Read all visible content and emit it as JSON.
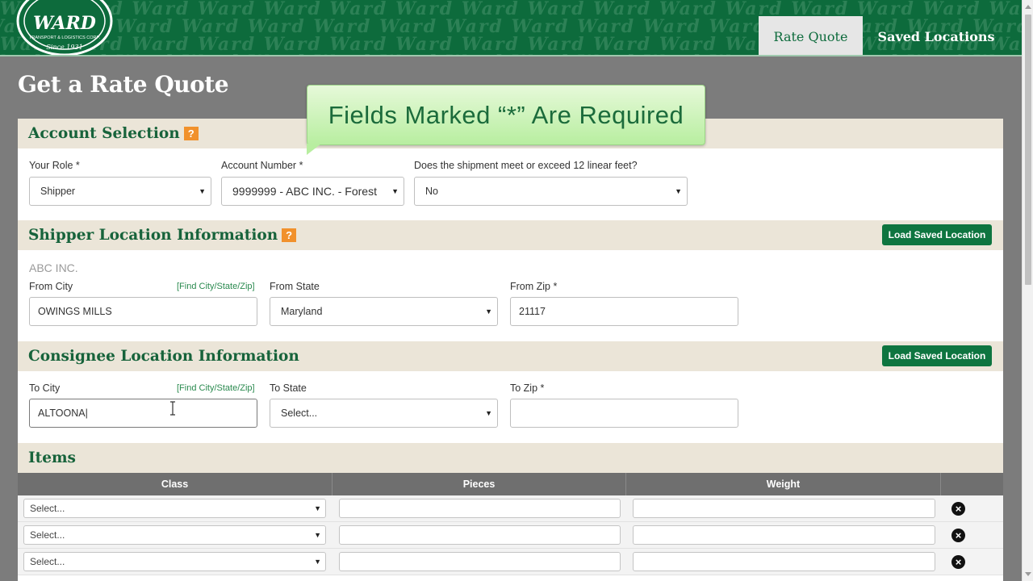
{
  "header": {
    "logo": {
      "name": "WARD",
      "subtitle": "TRANSPORT & LOGISTICS CORP.",
      "since": "Since 1931"
    },
    "tabs": [
      {
        "label": "Rate Quote",
        "active": true
      },
      {
        "label": "Saved Locations",
        "active": false
      }
    ],
    "pattern_text": "Ward"
  },
  "page_title": "Get a Rate Quote",
  "tooltip": "Fields Marked “*” Are Required",
  "account_selection": {
    "title": "Account Selection",
    "help": "?",
    "role_label": "Your Role *",
    "role_value": "Shipper",
    "account_label": "Account Number *",
    "account_value": "9999999 - ABC INC. - Forest",
    "linear_label": "Does the shipment meet or exceed 12 linear feet?",
    "linear_value": "No"
  },
  "shipper": {
    "title": "Shipper Location Information",
    "help": "?",
    "load_button": "Load Saved Location",
    "company": "ABC INC.",
    "city_label": "From City",
    "find_link": "[Find City/State/Zip]",
    "city_value": "OWINGS MILLS",
    "state_label": "From State",
    "state_value": "Maryland",
    "zip_label": "From Zip *",
    "zip_value": "21117"
  },
  "consignee": {
    "title": "Consignee Location Information",
    "load_button": "Load Saved Location",
    "city_label": "To City",
    "find_link": "[Find City/State/Zip]",
    "city_value": "ALTOONA|",
    "state_label": "To State",
    "state_value": "Select...",
    "zip_label": "To Zip *",
    "zip_value": ""
  },
  "items": {
    "title": "Items",
    "columns": [
      "Class",
      "Pieces",
      "Weight"
    ],
    "rows": [
      {
        "class_value": "Select..."
      },
      {
        "class_value": "Select..."
      },
      {
        "class_value": "Select..."
      }
    ]
  },
  "colors": {
    "brand_green": "#0d6b3c",
    "section_bg": "#ebe5d8",
    "help_orange": "#f1912c",
    "page_bg": "#7c7c7c"
  },
  "icons": {
    "caret": "caret-down-icon",
    "delete": "remove-circle-icon",
    "help": "help-icon"
  }
}
